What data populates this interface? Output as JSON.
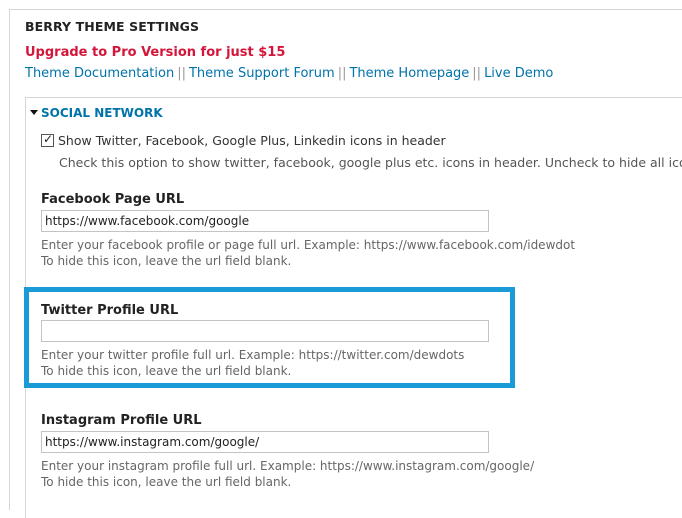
{
  "header": {
    "title": "BERRY THEME SETTINGS",
    "upgrade": "Upgrade to Pro Version for just $15",
    "links": [
      "Theme Documentation",
      "Theme Support Forum",
      "Theme Homepage",
      "Live Demo"
    ],
    "separator": "||"
  },
  "section": {
    "title": "SOCIAL NETWORK",
    "checkbox_label": "Show Twitter, Facebook, Google Plus, Linkedin icons in header",
    "checkbox_checked": true,
    "checkbox_desc": "Check this option to show twitter, facebook, google plus etc. icons in header. Uncheck to hide all icons."
  },
  "fields": [
    {
      "label": "Facebook Page URL",
      "value": "https://www.facebook.com/google",
      "desc1": "Enter your facebook profile or page full url. Example: https://www.facebook.com/idewdot",
      "desc2": "To hide this icon, leave the url field blank."
    },
    {
      "label": "Twitter Profile URL",
      "value": "",
      "desc1": "Enter your twitter profile full url. Example: https://twitter.com/dewdots",
      "desc2": "To hide this icon, leave the url field blank."
    },
    {
      "label": "Instagram Profile URL",
      "value": "https://www.instagram.com/google/",
      "desc1": "Enter your instagram profile full url. Example: https://www.instagram.com/google/",
      "desc2": "To hide this icon, leave the url field blank."
    }
  ],
  "highlight_color": "#1a9bd8"
}
